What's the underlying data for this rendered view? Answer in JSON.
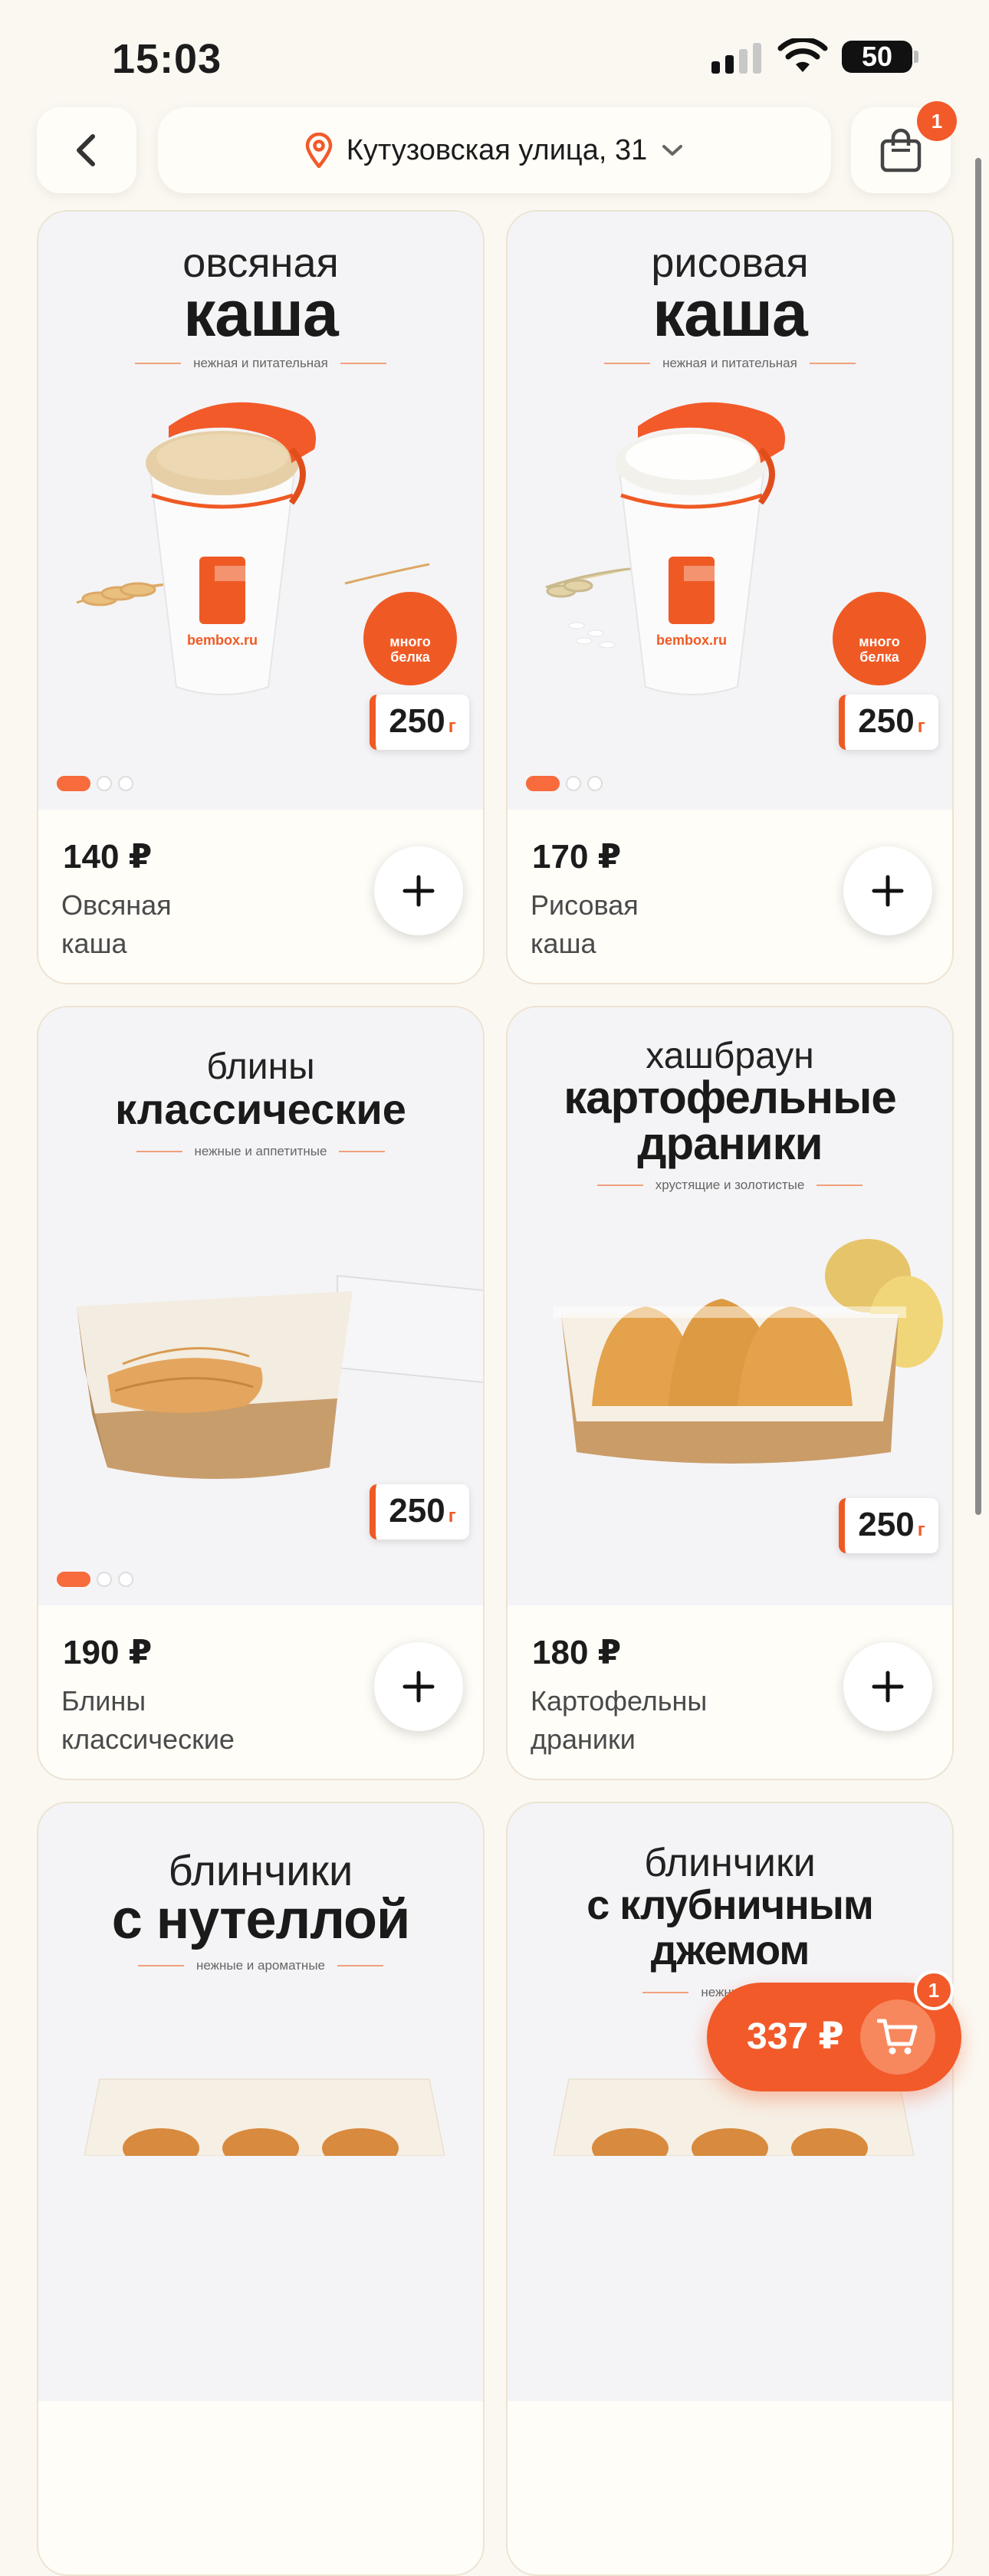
{
  "status_bar": {
    "time": "15:03",
    "battery": "50"
  },
  "header": {
    "address": "Кутузовская улица, 31",
    "cart_badge": "1"
  },
  "products": [
    {
      "title_top": "овсяная",
      "title_main": "каша",
      "tagline": "нежная и питательная",
      "badge": "много белка",
      "weight": "250",
      "weight_unit": "г",
      "price": "140 ₽",
      "name": "Овсяная каша"
    },
    {
      "title_top": "рисовая",
      "title_main": "каша",
      "tagline": "нежная и питательная",
      "badge": "много белка",
      "weight": "250",
      "weight_unit": "г",
      "price": "170 ₽",
      "name": "Рисовая каша"
    },
    {
      "title_top": "блины",
      "title_main": "классические",
      "tagline": "нежные и аппетитные",
      "weight": "250",
      "weight_unit": "г",
      "price": "190 ₽",
      "name": "Блины классические"
    },
    {
      "title_top": "хашбраун",
      "title_main": "картофельные драники",
      "tagline": "хрустящие и золотистые",
      "weight": "250",
      "weight_unit": "г",
      "price": "180 ₽",
      "name": "Картофельные драники"
    },
    {
      "title_top": "блинчики",
      "title_main": "с нутеллой",
      "tagline": "нежные и ароматные"
    },
    {
      "title_top": "блинчики",
      "title_main": "с клубничным джемом",
      "tagline": "нежные и"
    }
  ],
  "brand": "bembox.ru",
  "floating_cart": {
    "total": "337 ₽",
    "count": "1"
  },
  "colors": {
    "accent": "#f25a2a",
    "background": "#fbf8f2"
  },
  "icons": [
    "back-arrow-icon",
    "location-pin-icon",
    "chevron-down-icon",
    "shopping-bag-icon",
    "plus-icon",
    "cart-icon"
  ]
}
